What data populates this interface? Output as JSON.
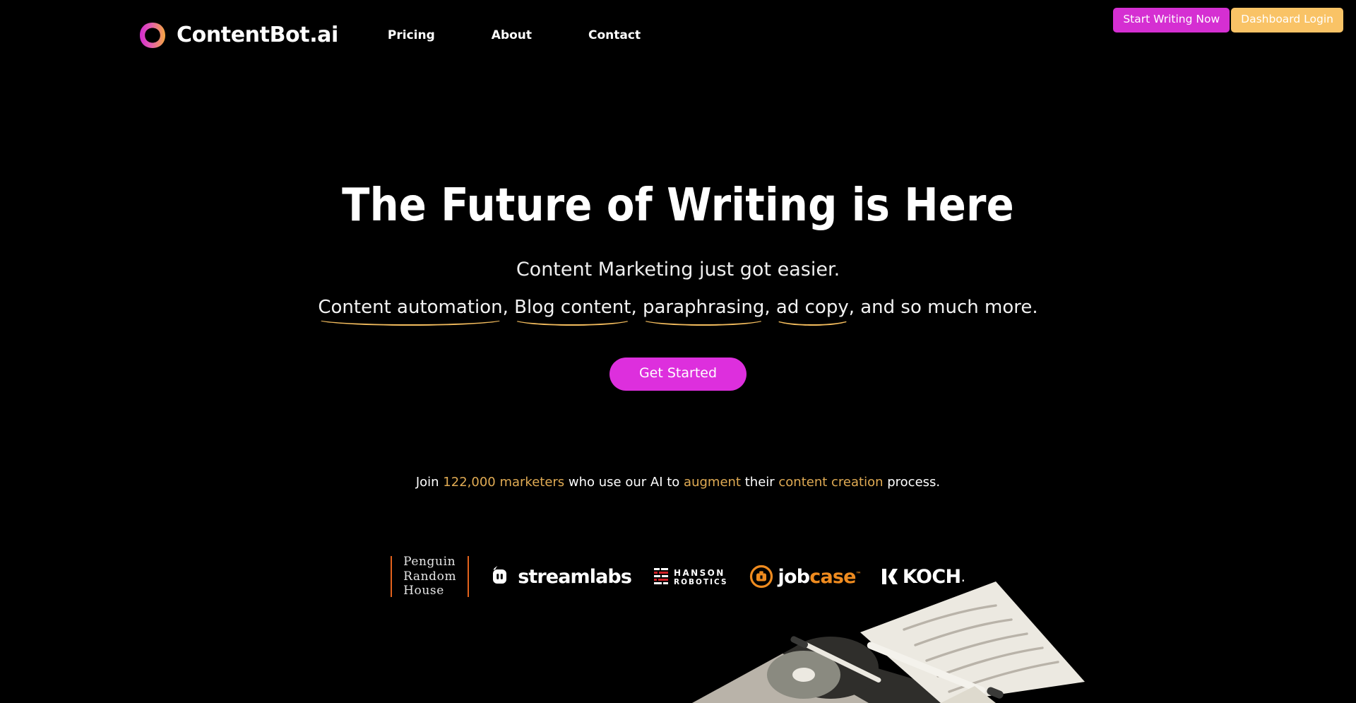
{
  "brand": {
    "name": "ContentBot.ai",
    "logo_icon": "ring-logo-icon",
    "gradient_from": "#d42ad0",
    "gradient_to": "#f5a83f"
  },
  "nav": {
    "links": [
      {
        "label": "Pricing"
      },
      {
        "label": "About"
      },
      {
        "label": "Contact"
      }
    ]
  },
  "topbar": {
    "start_writing_label": "Start Writing Now",
    "dashboard_login_label": "Dashboard Login",
    "start_writing_color": "#d52fd2",
    "dashboard_login_color": "#f9c366"
  },
  "hero": {
    "headline": "The Future of Writing is Here",
    "subhead": "Content Marketing just got easier.",
    "features": {
      "items": [
        "Content automation",
        "Blog content",
        "paraphrasing",
        "ad copy"
      ],
      "comma": ",",
      "tail": ", and so much more.",
      "underline_color": "#f4bd5e"
    },
    "cta_label": "Get Started",
    "cta_color": "#dd2fdd"
  },
  "social_proof": {
    "prefix": "Join ",
    "count": "122,000 marketers",
    "mid1": " who use our AI to ",
    "highlight1": "augment",
    "mid2": " their ",
    "highlight2": "content creation",
    "suffix": " process.",
    "highlight_color": "#e0ab54"
  },
  "logos": {
    "penguin_random_house": {
      "line1": "Penguin",
      "line2": "Random",
      "line3": "House"
    },
    "streamlabs": {
      "label": "streamlabs",
      "icon": "streamlabs-icon"
    },
    "hanson": {
      "line1": "HANSON",
      "line2": "ROBOTICS",
      "icon": "hanson-bars-icon"
    },
    "jobcase": {
      "part1": "job",
      "part2": "case",
      "tm": "™",
      "icon": "jobcase-briefcase-icon"
    },
    "koch": {
      "label": "KOCH",
      "dot": ".",
      "icon": "koch-block-icon"
    }
  },
  "illustration": {
    "name": "papers-and-pen-illustration",
    "paper_color": "#ece9e1",
    "pen_color": "#3a3a38",
    "disc_color": "#8a8a80"
  }
}
